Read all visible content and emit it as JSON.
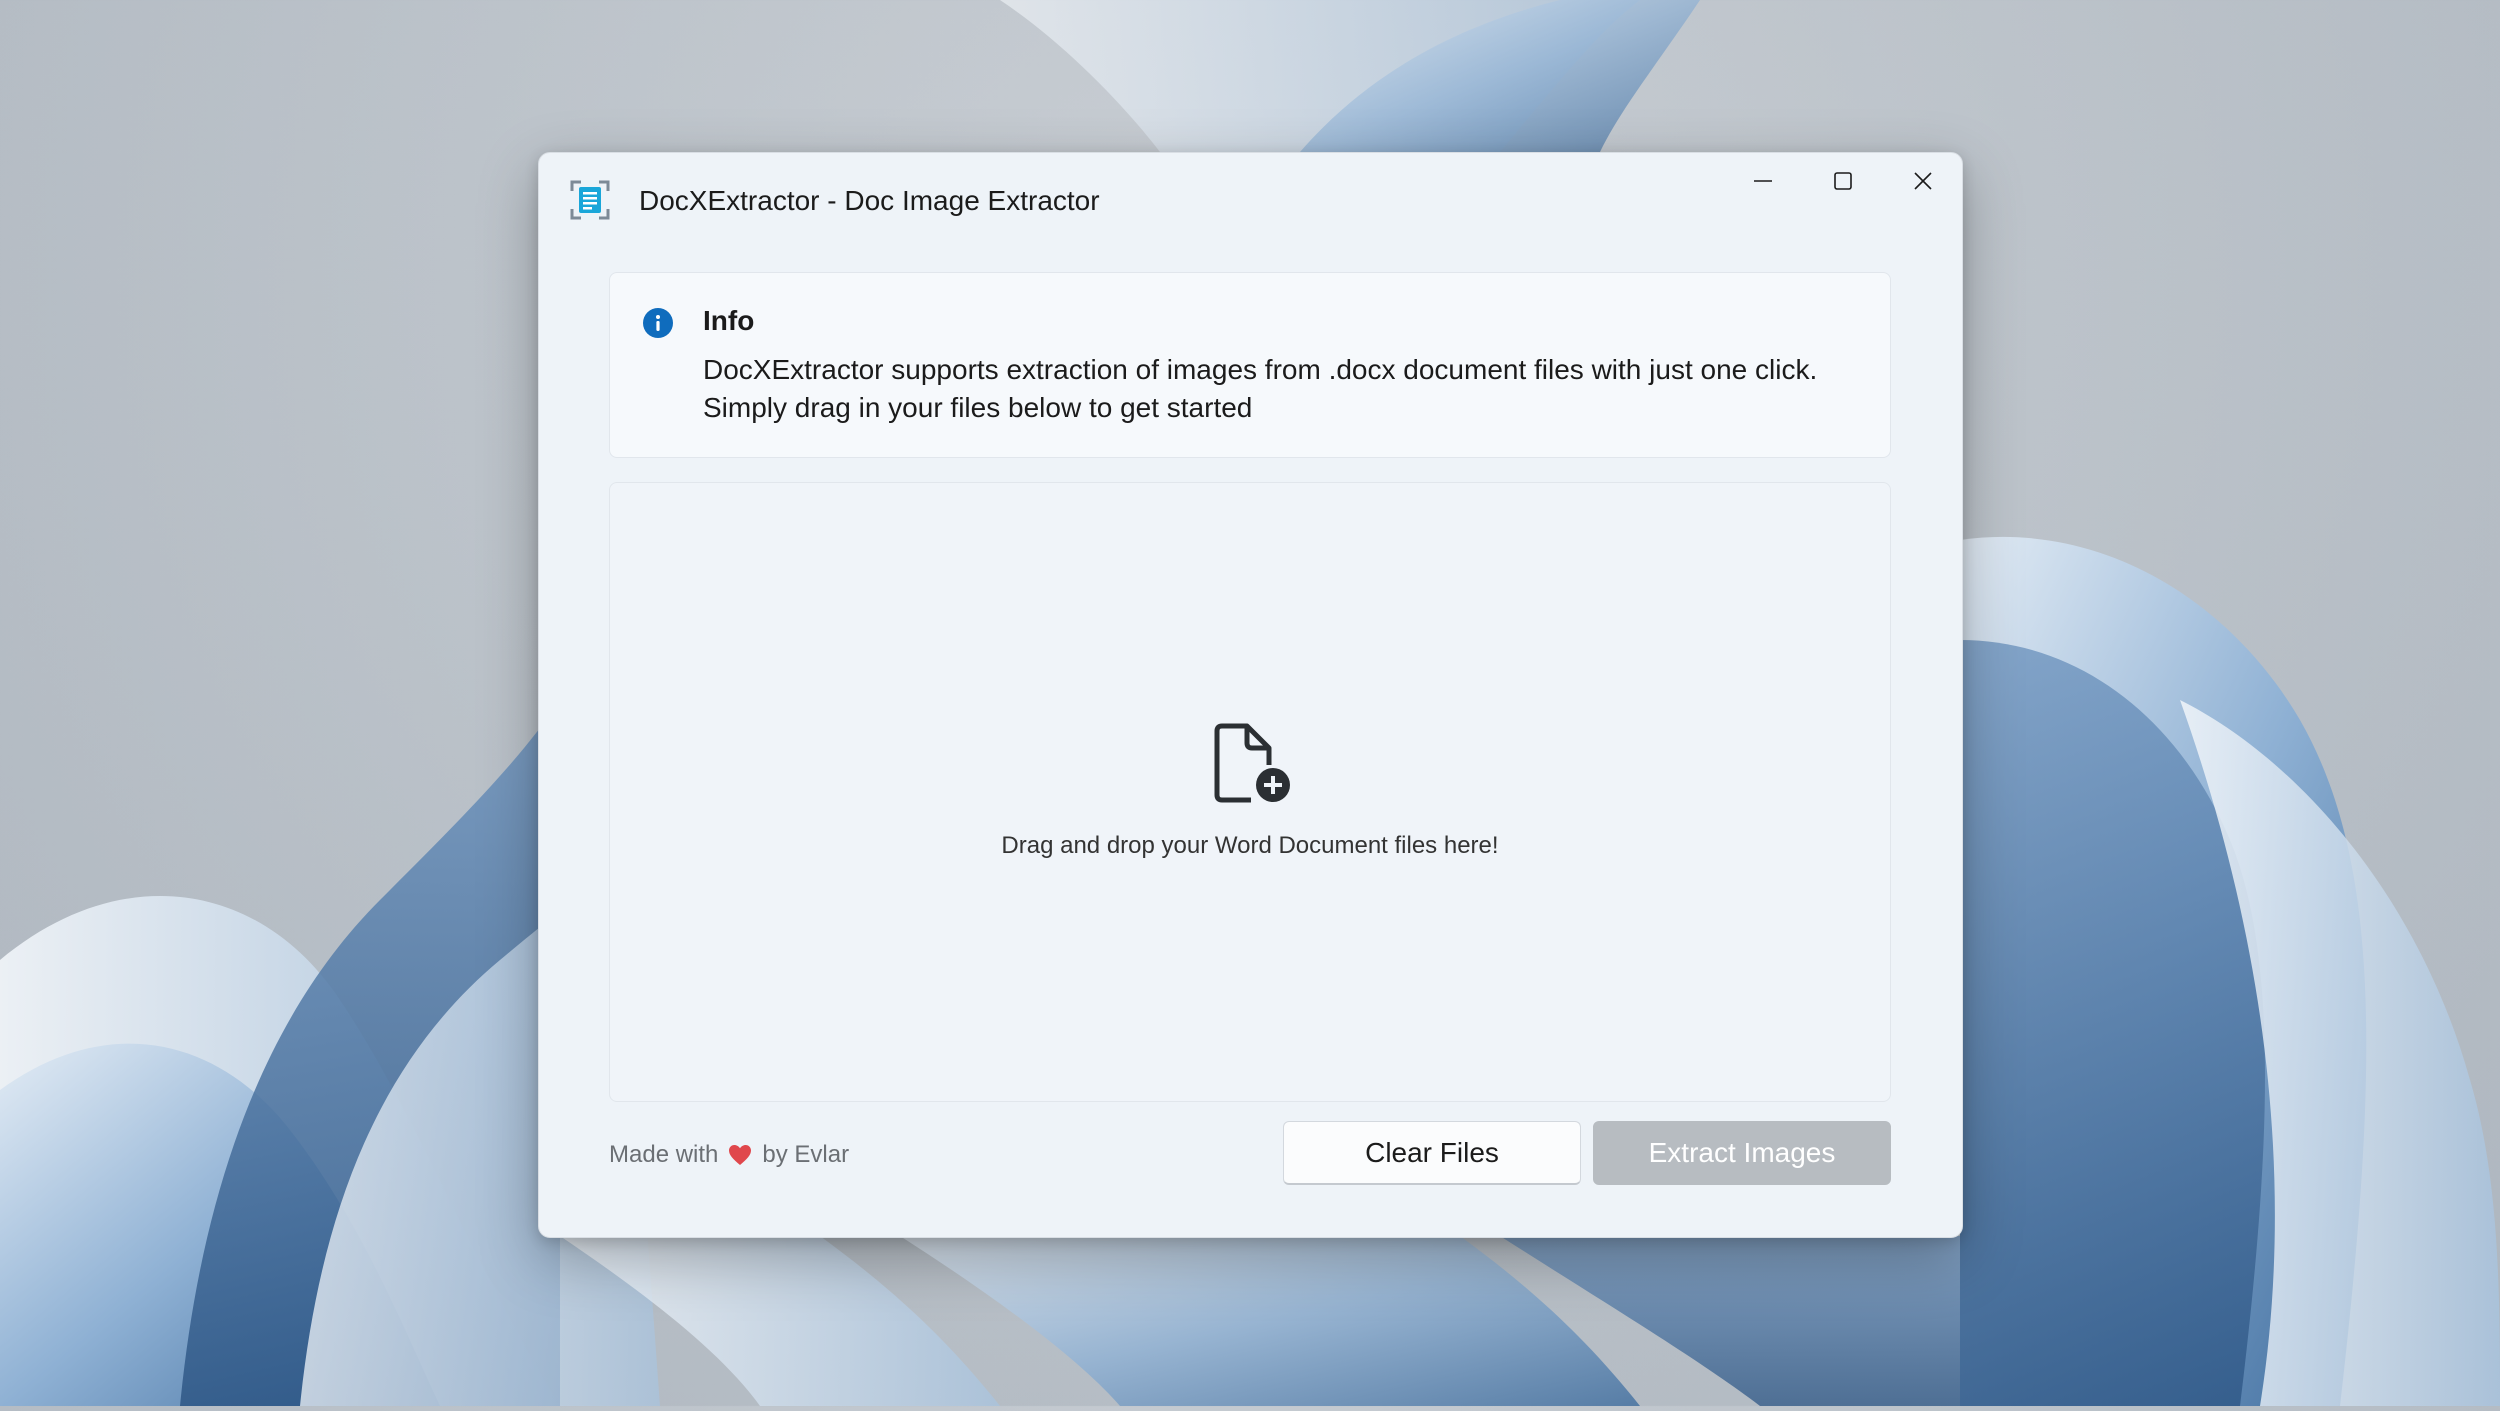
{
  "window": {
    "title": "DocXExtractor - Doc Image Extractor"
  },
  "info_bar": {
    "title": "Info",
    "message_line1": "DocXExtractor supports extraction of images from .docx document files with just one click.",
    "message_line2": "Simply drag in your files below to get started",
    "icon": "info-icon",
    "accent_color": "#0f6cbd"
  },
  "drop_zone": {
    "icon": "document-add-icon",
    "label": "Drag and drop your Word Document files here!"
  },
  "footer": {
    "credit_prefix": "Made with",
    "credit_icon": "heart-icon",
    "credit_suffix": "by Evlar",
    "heart_color": "#e0474c"
  },
  "actions": {
    "clear_label": "Clear Files",
    "extract_label": "Extract Images",
    "extract_enabled": false
  }
}
